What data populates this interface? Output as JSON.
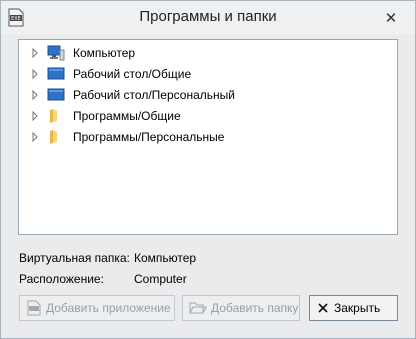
{
  "window": {
    "title": "Программы и папки",
    "close_glyph": "✕"
  },
  "tree": {
    "items": [
      {
        "label": "Компьютер",
        "icon": "computer-icon"
      },
      {
        "label": "Рабочий стол/Общие",
        "icon": "desktop-icon"
      },
      {
        "label": "Рабочий стол/Персональный",
        "icon": "desktop-icon"
      },
      {
        "label": "Программы/Общие",
        "icon": "folder-icon"
      },
      {
        "label": "Программы/Персональные",
        "icon": "folder-icon"
      }
    ]
  },
  "info": {
    "virtual_folder_label": "Виртуальная папка:",
    "virtual_folder_value": "Компьютер",
    "location_label": "Расположение:",
    "location_value": "Computer"
  },
  "buttons": {
    "add_app": "Добавить приложение",
    "add_folder": "Добавить папку",
    "close": "Закрыть"
  }
}
